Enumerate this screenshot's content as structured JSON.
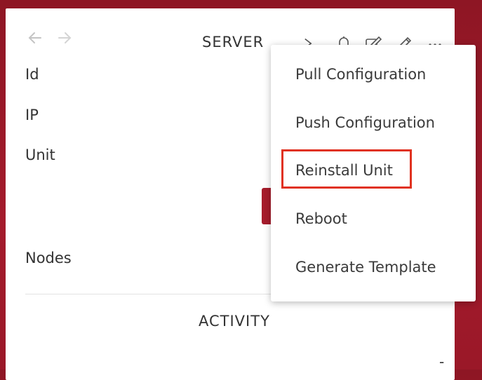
{
  "header": {
    "title": "SERVER",
    "back_icon": "back-arrow-icon",
    "forward_icon": "forward-arrow-icon"
  },
  "toolbar": {
    "icons": [
      "terminal-icon",
      "bell-icon",
      "edit-box-icon",
      "pencil-icon",
      "more-icon"
    ]
  },
  "fields": {
    "id_label": "Id",
    "ip_label": "IP",
    "unit_label": "Unit",
    "nodes_label": "Nodes"
  },
  "activity": {
    "title": "ACTIVITY",
    "value": "-"
  },
  "menu": {
    "items": [
      "Pull Configuration",
      "Push Configuration",
      "Reinstall Unit",
      "Reboot",
      "Generate Template"
    ],
    "highlighted_index": 2
  },
  "colors": {
    "brand": "#a61c2c",
    "highlight_border": "#e0311f"
  }
}
